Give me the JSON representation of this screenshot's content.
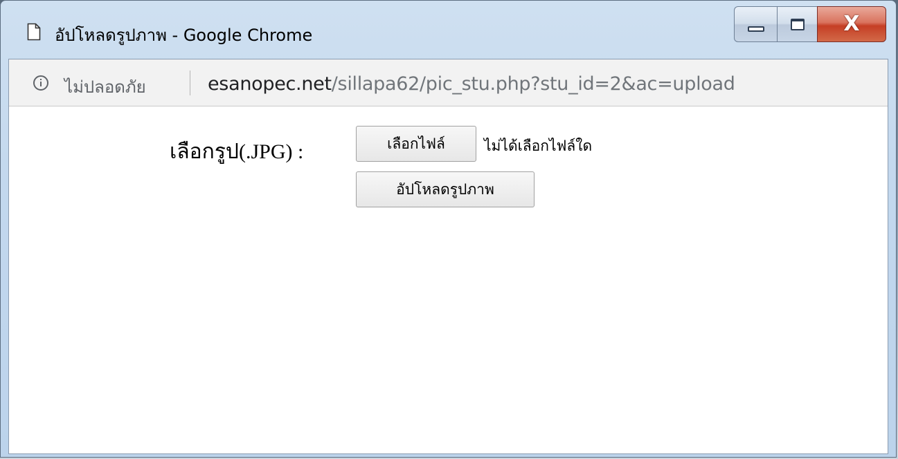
{
  "window": {
    "title": "อัปโหลดรูปภาพ - Google Chrome",
    "close_glyph": "X"
  },
  "address_bar": {
    "security_label": "ไม่ปลอดภัย",
    "url_host": "esanopec.net",
    "url_path": "/sillapa62/pic_stu.php?stu_id=2&ac=upload"
  },
  "form": {
    "label": "เลือกรูป(.JPG) :",
    "choose_file_button": "เลือกไฟล์",
    "file_status": "ไม่ได้เลือกไฟล์ใด",
    "upload_button": "อัปโหลดรูปภาพ"
  },
  "icons": {
    "page": "page-icon",
    "info": "info-icon",
    "minimize": "minimize-icon",
    "maximize": "maximize-icon",
    "close": "close-icon"
  }
}
